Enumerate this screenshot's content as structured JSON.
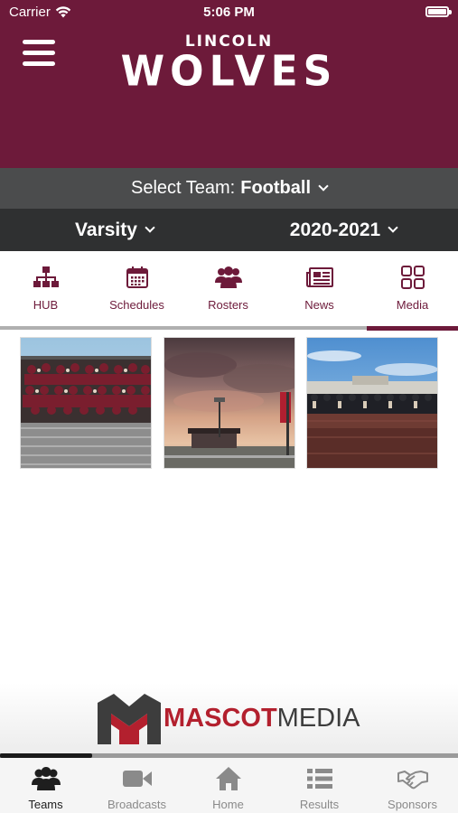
{
  "status_bar": {
    "carrier": "Carrier",
    "time": "5:06 PM"
  },
  "header": {
    "logo_small": "LINCOLN",
    "logo_big": "WOLVES"
  },
  "team_select": {
    "label": "Select Team:",
    "value": "Football"
  },
  "level_select": {
    "value": "Varsity"
  },
  "season_select": {
    "value": "2020-2021"
  },
  "tabs": [
    {
      "label": "HUB",
      "icon": "hierarchy-icon"
    },
    {
      "label": "Schedules",
      "icon": "calendar-icon"
    },
    {
      "label": "Rosters",
      "icon": "group-icon"
    },
    {
      "label": "News",
      "icon": "newspaper-icon"
    },
    {
      "label": "Media",
      "icon": "grid-icon"
    }
  ],
  "active_tab": "Media",
  "banner": {
    "brand_a": "MASCOT",
    "brand_b": "MEDIA"
  },
  "bottom_nav": [
    {
      "label": "Teams",
      "icon": "people-icon"
    },
    {
      "label": "Broadcasts",
      "icon": "video-camera-icon"
    },
    {
      "label": "Home",
      "icon": "home-icon"
    },
    {
      "label": "Results",
      "icon": "list-icon"
    },
    {
      "label": "Sponsors",
      "icon": "handshake-icon"
    }
  ],
  "active_bottom": "Teams",
  "colors": {
    "primary": "#6d1a3a",
    "bar_light": "#4b4c4d",
    "bar_dark": "#2f3031",
    "brand_red": "#b3202e"
  }
}
